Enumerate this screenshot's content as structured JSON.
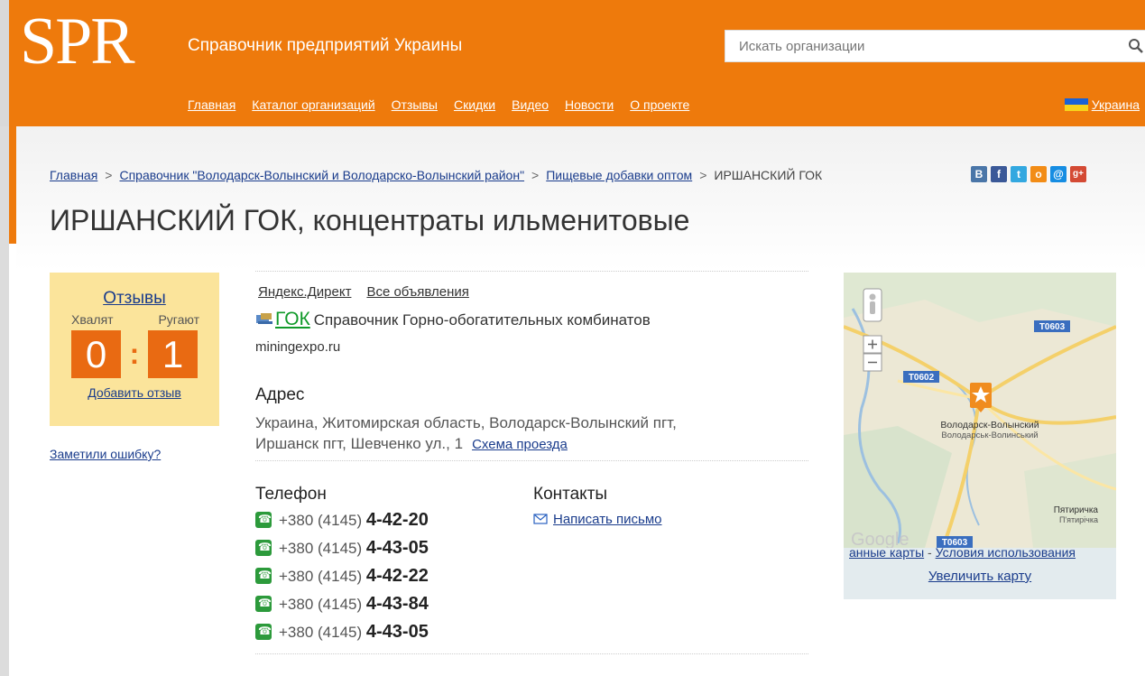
{
  "header": {
    "logo": "SPR",
    "tagline": "Справочник предприятий Украины",
    "search_placeholder": "Искать организации",
    "nav": [
      "Главная",
      "Каталог организаций",
      "Отзывы",
      "Скидки",
      "Видео",
      "Новости",
      "О проекте"
    ],
    "country": "Украина"
  },
  "breadcrumb": {
    "items": [
      "Главная",
      "Справочник \"Володарск-Волынский и Володарско-Волынский район\"",
      "Пищевые добавки оптом"
    ],
    "current": "ИРШАНСКИЙ ГОК",
    "separator": ">"
  },
  "social": [
    {
      "name": "vk",
      "glyph": "В",
      "color": "#4a76a8"
    },
    {
      "name": "facebook",
      "glyph": "f",
      "color": "#3b5998"
    },
    {
      "name": "twitter",
      "glyph": "t",
      "color": "#33a8e0"
    },
    {
      "name": "odnoklassniki",
      "glyph": "o",
      "color": "#f28c16"
    },
    {
      "name": "mailru",
      "glyph": "@",
      "color": "#168de2"
    },
    {
      "name": "googleplus",
      "glyph": "g+",
      "color": "#d44a34"
    }
  ],
  "title": "ИРШАНСКИЙ ГОК, концентраты ильменитовые",
  "reviews": {
    "title": "Отзывы",
    "praise_label": "Хвалят",
    "blame_label": "Ругают",
    "praise_count": "0",
    "blame_count": "1",
    "add_link": "Добавить отзыв"
  },
  "error_link": "Заметили ошибку?",
  "ads": {
    "direct": "Яндекс.Директ",
    "all": "Все объявления",
    "ad_title": "ГОК",
    "ad_text": "Справочник Горно-обогатительных комбинатов",
    "ad_domain": "miningexpo.ru"
  },
  "address": {
    "heading": "Адрес",
    "line1": "Украина, Житомирская область, Володарск-Волынский пгт,",
    "line2": "Иршанск пгт, Шевченко ул., 1",
    "route_link": "Схема проезда"
  },
  "phones": {
    "heading": "Телефон",
    "prefix": "+380 (4145)",
    "numbers": [
      "4-42-20",
      "4-43-05",
      "4-42-22",
      "4-43-84",
      "4-43-05"
    ]
  },
  "contacts": {
    "heading": "Контакты",
    "write_link": "Написать письмо"
  },
  "map": {
    "road1": "T0603",
    "road2": "T0602",
    "road3": "T0603",
    "city": "Володарск-Волынский",
    "city_ua": "Володарськ-Волинський",
    "village": "Пятиричка",
    "village_ua": "П'ятирічка",
    "google": "Google",
    "map_data": "анные карты",
    "dash": " - ",
    "terms": "Условия использования",
    "enlarge": "Увеличить карту"
  }
}
